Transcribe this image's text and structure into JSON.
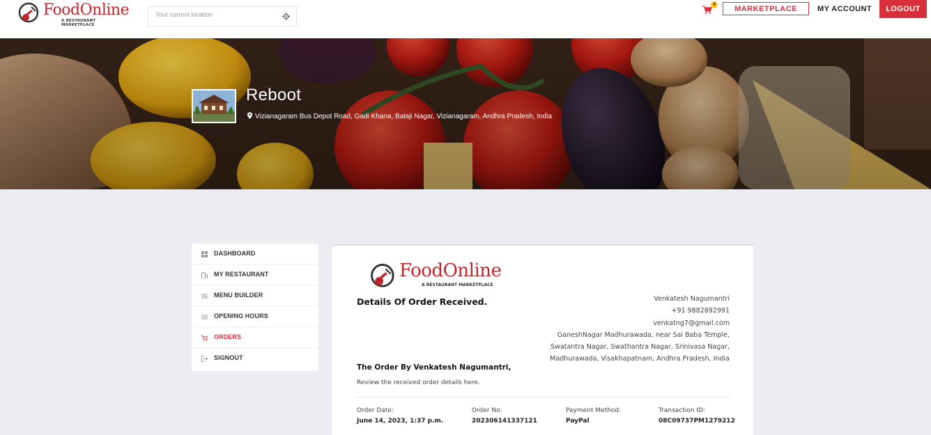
{
  "header": {
    "brand": "FoodOnline",
    "tagline": "A RESTAURANT MARKETPLACE",
    "location_placeholder": "Your current location",
    "cart_count": "0",
    "marketplace_label": "MARKETPLACE",
    "account_label": "MY ACCOUNT",
    "logout_label": "LOGOUT"
  },
  "banner": {
    "restaurant_name": "Reboot",
    "address": "Vizianagaram Bus Depot Road, Gadi Khana, Balaji Nagar, Vizianagaram, Andhra Pradesh, India"
  },
  "sidebar": {
    "items": [
      {
        "label": "DASHBOARD",
        "icon": "grid-icon"
      },
      {
        "label": "MY RESTAURANT",
        "icon": "building-icon"
      },
      {
        "label": "MENU BUILDER",
        "icon": "list-icon"
      },
      {
        "label": "OPENING HOURS",
        "icon": "list-icon"
      },
      {
        "label": "ORDERS",
        "icon": "cart-icon",
        "active": true
      },
      {
        "label": "SIGNOUT",
        "icon": "signout-icon"
      }
    ]
  },
  "order": {
    "brand": "FoodOnline",
    "tagline": "A RESTAURANT MARKETPLACE",
    "title": "Details Of Order Received.",
    "customer": {
      "name": "Venkatesh Nagumantri",
      "phone": "+91 9882892991",
      "email": "venkatng7@gmail.com",
      "address_lines": [
        "GaneshNagar Madhurawada, near Sai Baba Temple,",
        "Swatantra Nagar, Swathantra Nagar, Srinivasa Nagar,",
        "Madhurawada, Visakhapatnam, Andhra Pradesh, India"
      ]
    },
    "order_by": "The Order By Venkatesh Nagumantri,",
    "review_text": "Review the received order details here.",
    "meta": {
      "date_label": "Order Date:",
      "date_value": "June 14, 2023, 1:37 p.m.",
      "no_label": "Order No:",
      "no_value": "20230614133712​1",
      "payment_label": "Payment Method:",
      "payment_value": "PayPal",
      "txn_label": "Transaction ID:",
      "txn_value": "08C09737PM1279212"
    }
  },
  "colors": {
    "accent": "#d8303b",
    "badge": "#f9c41e",
    "page_bg": "#ecedf2"
  }
}
